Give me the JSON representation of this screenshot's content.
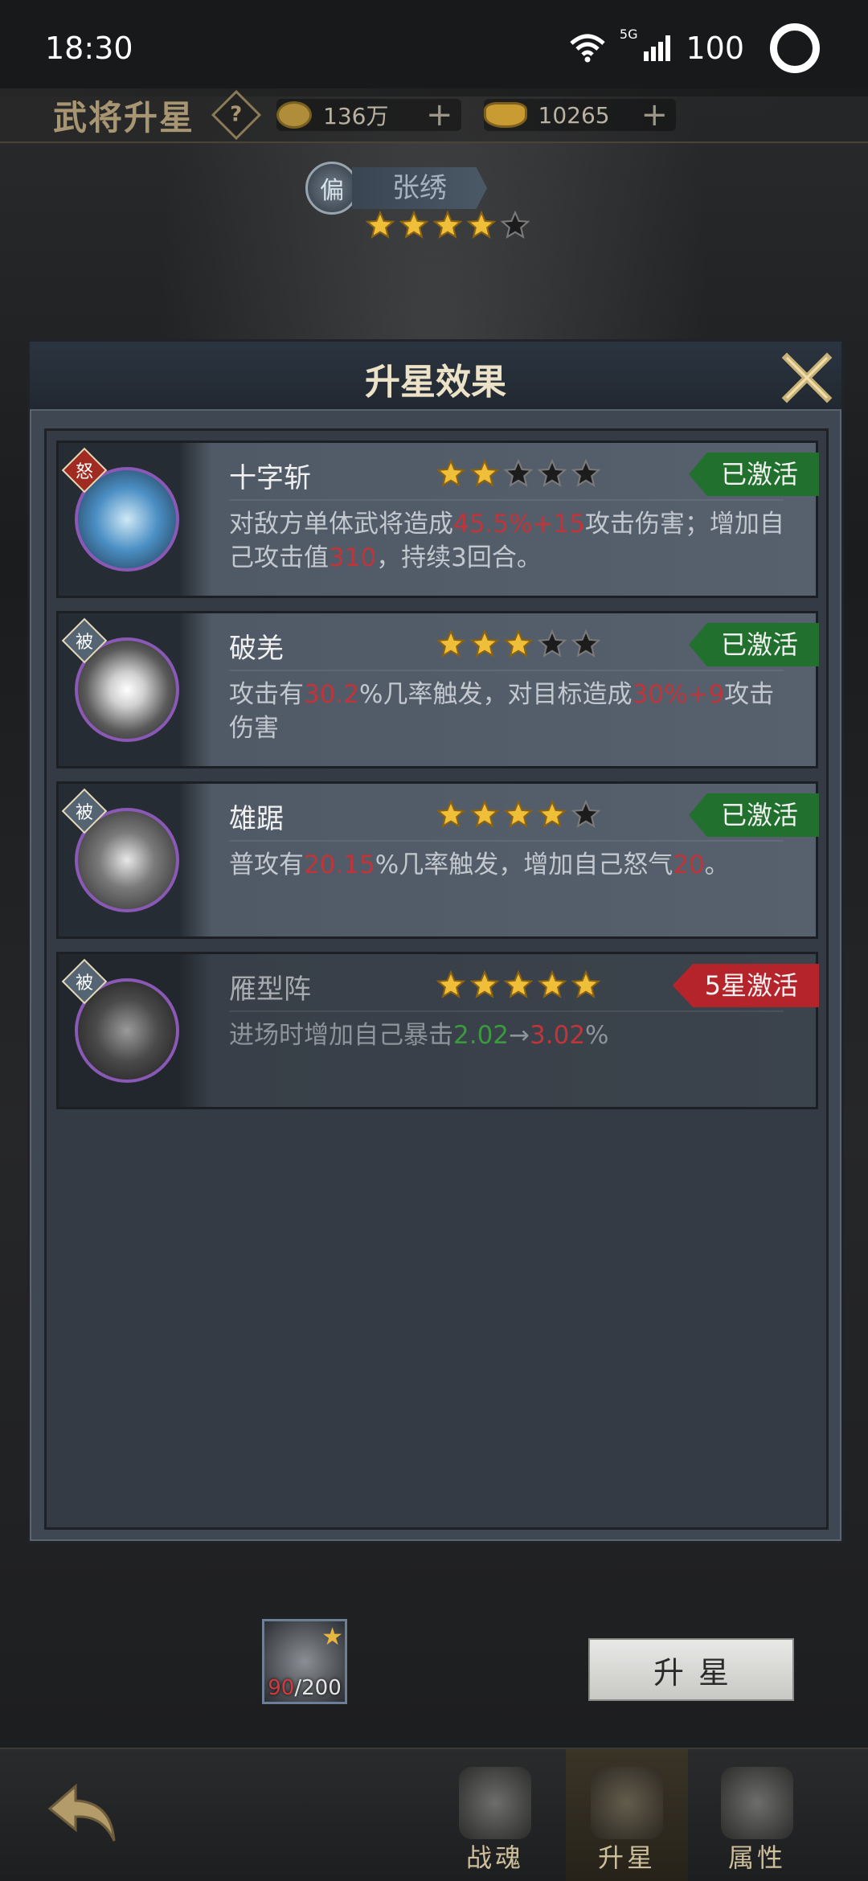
{
  "status_bar": {
    "time": "18:30",
    "network": "5G",
    "battery": "100"
  },
  "header": {
    "title": "武将升星",
    "help_label": "?",
    "coins": "136万",
    "ingots": "10265"
  },
  "hero": {
    "badge": "偏",
    "name": "张绣",
    "stars": 4,
    "max_stars": 5
  },
  "modal": {
    "title": "升星效果",
    "skills": [
      {
        "tag": "怒",
        "tag_type": "rage",
        "name": "十字斩",
        "stars": 2,
        "status": "已激活",
        "active": true,
        "desc": [
          {
            "t": "对敌方单体武将造成",
            "c": ""
          },
          {
            "t": "45.5%+15",
            "c": "red"
          },
          {
            "t": "攻击伤害；增加自己攻击值",
            "c": ""
          },
          {
            "t": "310",
            "c": "red"
          },
          {
            "t": "，持续3回合。",
            "c": ""
          }
        ]
      },
      {
        "tag": "被",
        "tag_type": "passive",
        "name": "破羌",
        "stars": 3,
        "status": "已激活",
        "active": true,
        "desc": [
          {
            "t": "攻击有",
            "c": ""
          },
          {
            "t": "30.2",
            "c": "red"
          },
          {
            "t": "%几率触发，对目标造成",
            "c": ""
          },
          {
            "t": "30%+9",
            "c": "red"
          },
          {
            "t": "攻击伤害",
            "c": ""
          }
        ]
      },
      {
        "tag": "被",
        "tag_type": "passive",
        "name": "雄踞",
        "stars": 4,
        "status": "已激活",
        "active": true,
        "desc": [
          {
            "t": "普攻有",
            "c": ""
          },
          {
            "t": "20.15",
            "c": "red"
          },
          {
            "t": "%几率触发，增加自己怒气",
            "c": ""
          },
          {
            "t": "20",
            "c": "red"
          },
          {
            "t": "。",
            "c": ""
          }
        ]
      },
      {
        "tag": "被",
        "tag_type": "passive",
        "name": "雁型阵",
        "stars": 5,
        "status": "5星激活",
        "active": false,
        "desc": [
          {
            "t": "进场时增加自己暴击",
            "c": ""
          },
          {
            "t": "2.02",
            "c": "green"
          },
          {
            "t": "→",
            "c": ""
          },
          {
            "t": "3.02",
            "c": "red"
          },
          {
            "t": "%",
            "c": ""
          }
        ]
      }
    ]
  },
  "bottom": {
    "fragment_current": "90",
    "fragment_total": "/200",
    "upgrade_button": "升星",
    "tabs": [
      {
        "label": "战魂",
        "selected": false
      },
      {
        "label": "升星",
        "selected": true
      },
      {
        "label": "属性",
        "selected": false
      }
    ]
  },
  "colors": {
    "active_tag": "#22702d",
    "inactive_tag": "#b5242a",
    "highlight_red": "#c0343a",
    "highlight_green": "#3a9a3e",
    "star_gold": "#f0bf3a"
  }
}
